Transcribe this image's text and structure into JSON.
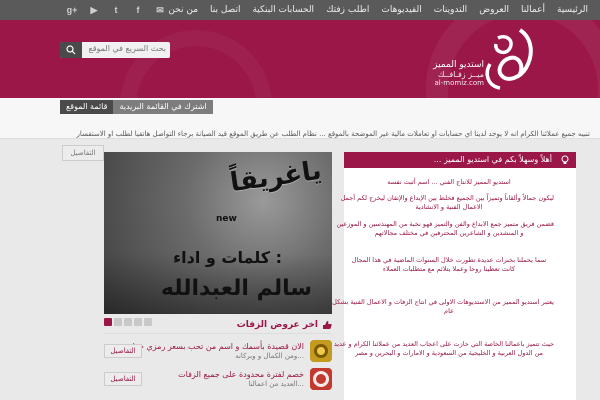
{
  "nav": {
    "items": [
      "الرئيسية",
      "أعمالنا",
      "العروض",
      "التدوينات",
      "الفيديوهات",
      "اطلب زفتك",
      "الحسابات البنكية",
      "اتصل بنا",
      "من نحن"
    ]
  },
  "social": [
    "g+",
    "▶",
    "t",
    "f",
    "✉"
  ],
  "search": {
    "placeholder": "بحث السريع في الموقع"
  },
  "logo": {
    "line1": "استديو المميز",
    "line2": "ميــز زفـافــك",
    "line3": "al-momiz.com"
  },
  "tabs": {
    "map": "قائمة الموقع",
    "mailing": "اشترك في القائمة البريدية"
  },
  "ticker": {
    "text": "تنبيه جميع عملائنا الكرام انه لا يوجد لدينا اي حسابات او تعاملات مالية غير الموضحة بالموقع ... نظام الطلب عن طريق الموقع قيد الصيانة برجاء التواصل هاتفيا لطلب او الاستفسار",
    "details": "التفاصيل"
  },
  "featured": {
    "title": "ياغريقاً",
    "new_label": "new",
    "credit1": "كلمات و اداء :",
    "credit2": "سالم العبدالله"
  },
  "offers": {
    "section_title": "اخر عروض الزفات",
    "details_label": "التفاصيل",
    "items": [
      {
        "title": "الان قصيدة بأسمك و اسم من تحب بسعر رمزي جدا",
        "sub": "...ومن الكمال و وبركانه"
      },
      {
        "title": "خصم لفترة محدودة على جميع الزفات",
        "sub": "...العديد من اعمالنا"
      }
    ]
  },
  "welcome": {
    "header": "أهلاً وسهلاً بكم في استديو المميز ...",
    "lines": [
      "استديو المميز للانتاج الفني ... اسم أثبت نفسه",
      "ليكون جمالاً وألقاناً وتميزاً بين الجميع فخلط بين الإبداع والإتقان ليخرج لكم أجمل",
      "الاعمال الفنية و الانشادية",
      "فضمن فريق متميز جمع الابداع والفن والتميز فهو نخبة من المهندسين و الموزعين",
      "و المنشدين و الشاعرين المحترفين في مختلف مجالاتهم",
      "سما يحملنا بخبرات عديدة تطورت خلال السنوات الماضية في هذا المجال",
      "كانت تعطينا روحا وعملا يتلائم مع متطلبات العملاء",
      "يعتبر استديو المميز من الاستديوهات الاولى في انتاج الزفات و الاعمال الفنية بشكل",
      "عام",
      "حيث تتميز باعمالنا الخاصة التي حازت على اعجاب العديد من عملائنا الكرام و عديد",
      "من الدول العربية و الخليجية من السعودية و الامارات و البحرين و مصر"
    ]
  }
}
